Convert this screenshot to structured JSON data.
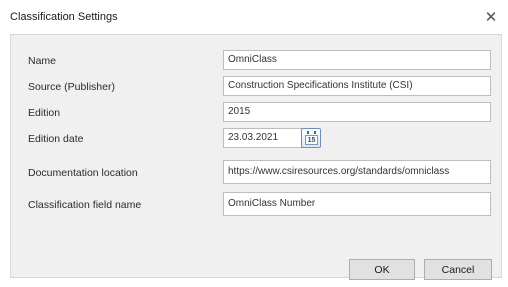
{
  "window": {
    "title": "Classification Settings",
    "close_glyph": "✕"
  },
  "form": {
    "rows": [
      {
        "label": "Name",
        "value": "OmniClass"
      },
      {
        "label": "Source (Publisher)",
        "value": "Construction Specifications Institute (CSI)"
      },
      {
        "label": "Edition",
        "value": "2015"
      },
      {
        "label": "Edition date",
        "value": "23.03.2021"
      },
      {
        "label": "Documentation location",
        "value": "https://www.csiresources.org/standards/omniclass"
      },
      {
        "label": "Classification field name",
        "value": "OmniClass Number"
      }
    ],
    "calendar_day": "15"
  },
  "buttons": {
    "ok_label": "OK",
    "cancel_label": "Cancel"
  },
  "icons": {
    "close": "close-icon",
    "calendar": "calendar-icon"
  }
}
